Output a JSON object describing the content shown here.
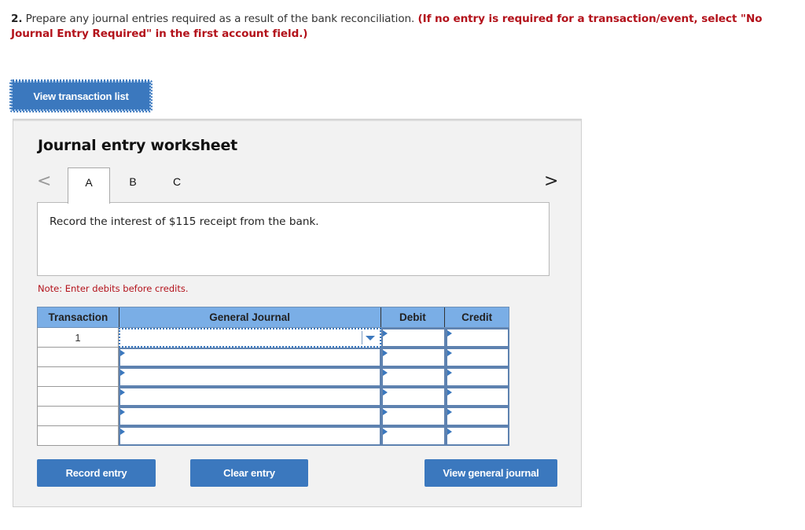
{
  "question": {
    "number": "2.",
    "text": " Prepare any journal entries required as a result of the bank reconciliation. ",
    "instruction": "(If no entry is required for a transaction/event, select \"No Journal Entry Required\" in the first account field.)"
  },
  "buttons": {
    "view_transaction_list": "View transaction list",
    "record_entry": "Record entry",
    "clear_entry": "Clear entry",
    "view_general_journal": "View general journal"
  },
  "worksheet": {
    "title": "Journal entry worksheet",
    "nav_prev": "<",
    "nav_next": ">",
    "tabs": [
      {
        "label": "A",
        "active": true
      },
      {
        "label": "B",
        "active": false
      },
      {
        "label": "C",
        "active": false
      }
    ],
    "description": "Record the interest of $115 receipt from the bank.",
    "note": "Note: Enter debits before credits.",
    "table": {
      "headers": [
        "Transaction",
        "General Journal",
        "Debit",
        "Credit"
      ],
      "rows": [
        {
          "transaction": "1",
          "account": "",
          "debit": "",
          "credit": ""
        },
        {
          "transaction": "",
          "account": "",
          "debit": "",
          "credit": ""
        },
        {
          "transaction": "",
          "account": "",
          "debit": "",
          "credit": ""
        },
        {
          "transaction": "",
          "account": "",
          "debit": "",
          "credit": ""
        },
        {
          "transaction": "",
          "account": "",
          "debit": "",
          "credit": ""
        },
        {
          "transaction": "",
          "account": "",
          "debit": "",
          "credit": ""
        }
      ]
    }
  },
  "colors": {
    "accent": "#3b78be",
    "header_bg": "#7aaee6",
    "instruction_red": "#b3121b",
    "panel_bg": "#f2f2f2"
  }
}
